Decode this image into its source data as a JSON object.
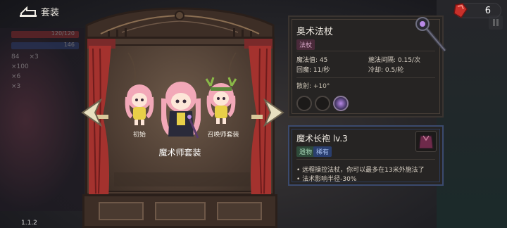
{
  "header": {
    "title": "套装",
    "gem_count": "6"
  },
  "hud": {
    "hp": "120/120",
    "mp": "146",
    "stat1": "84",
    "stat2": "×3",
    "stat3": "×100",
    "stat4": "×6",
    "stat5": "×3"
  },
  "wardrobe": {
    "characters": [
      {
        "label": "初始"
      },
      {
        "label": ""
      },
      {
        "label": "召唤师套装"
      }
    ],
    "set_name": "魔术师套装"
  },
  "weapon": {
    "name": "奥术法杖",
    "tag": "法杖",
    "magic_label": "魔法值: 45",
    "interval_label": "施法间隔: 0.15/次",
    "regen_label": "回魔: 11/秒",
    "cooldown_label": "冷却: 0.5/轮",
    "spread_label": "散射: +10°"
  },
  "item": {
    "name": "魔术长袍 lv.3",
    "tags": [
      "遗物",
      "稀有"
    ],
    "effects": [
      "远程操控法杖，你可以最多在13米外施法了",
      "法术影响半径-30%"
    ]
  },
  "version": "1.1.2",
  "colors": {
    "accent": "#b98ae8",
    "curtain": "#a4322e",
    "gold": "#d8c89a"
  }
}
